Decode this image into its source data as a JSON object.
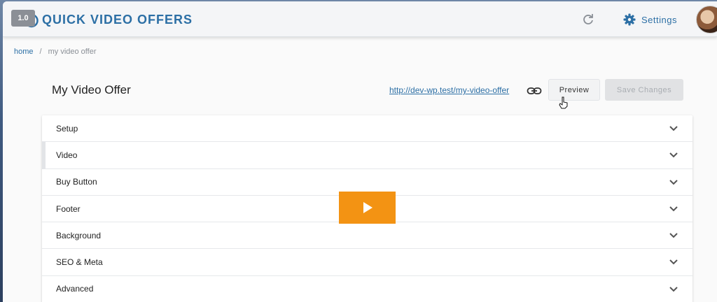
{
  "player": {
    "speed": "1.0"
  },
  "header": {
    "title": "QUICK VIDEO OFFERS",
    "settings_label": "Settings"
  },
  "breadcrumb": {
    "home": "home",
    "separator": "/",
    "current": "my video offer"
  },
  "offer": {
    "title": "My Video Offer",
    "url": "http://dev-wp.test/my-video-offer",
    "preview_label": "Preview",
    "save_label": "Save Changes"
  },
  "sections": [
    {
      "label": "Setup"
    },
    {
      "label": "Video"
    },
    {
      "label": "Buy Button"
    },
    {
      "label": "Footer"
    },
    {
      "label": "Background"
    },
    {
      "label": "SEO & Meta"
    },
    {
      "label": "Advanced"
    }
  ],
  "colors": {
    "brand": "#2c6fa5",
    "play_button": "#f39313"
  },
  "icons": [
    "timer-icon",
    "refresh-icon",
    "gear-icon",
    "link-icon",
    "chevron-down-icon",
    "play-icon",
    "cursor-icon"
  ]
}
